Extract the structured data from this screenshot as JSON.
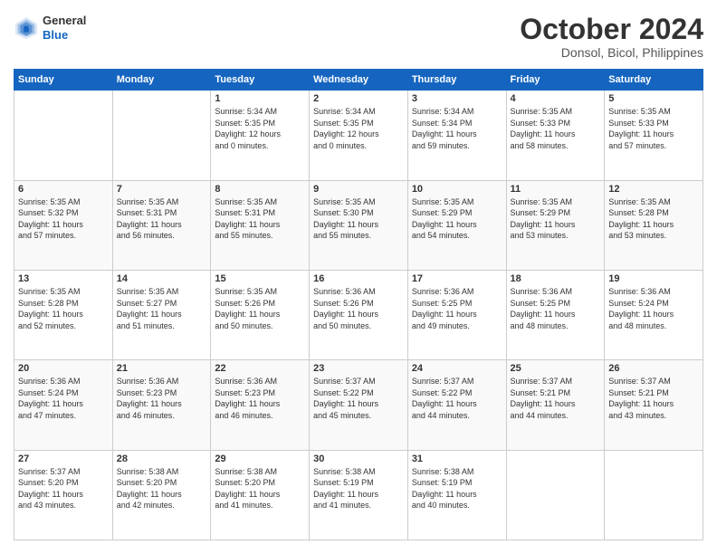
{
  "logo": {
    "line1": "General",
    "line2": "Blue"
  },
  "header": {
    "month": "October 2024",
    "location": "Donsol, Bicol, Philippines"
  },
  "days_of_week": [
    "Sunday",
    "Monday",
    "Tuesday",
    "Wednesday",
    "Thursday",
    "Friday",
    "Saturday"
  ],
  "weeks": [
    [
      {
        "day": "",
        "info": ""
      },
      {
        "day": "",
        "info": ""
      },
      {
        "day": "1",
        "info": "Sunrise: 5:34 AM\nSunset: 5:35 PM\nDaylight: 12 hours\nand 0 minutes."
      },
      {
        "day": "2",
        "info": "Sunrise: 5:34 AM\nSunset: 5:35 PM\nDaylight: 12 hours\nand 0 minutes."
      },
      {
        "day": "3",
        "info": "Sunrise: 5:34 AM\nSunset: 5:34 PM\nDaylight: 11 hours\nand 59 minutes."
      },
      {
        "day": "4",
        "info": "Sunrise: 5:35 AM\nSunset: 5:33 PM\nDaylight: 11 hours\nand 58 minutes."
      },
      {
        "day": "5",
        "info": "Sunrise: 5:35 AM\nSunset: 5:33 PM\nDaylight: 11 hours\nand 57 minutes."
      }
    ],
    [
      {
        "day": "6",
        "info": "Sunrise: 5:35 AM\nSunset: 5:32 PM\nDaylight: 11 hours\nand 57 minutes."
      },
      {
        "day": "7",
        "info": "Sunrise: 5:35 AM\nSunset: 5:31 PM\nDaylight: 11 hours\nand 56 minutes."
      },
      {
        "day": "8",
        "info": "Sunrise: 5:35 AM\nSunset: 5:31 PM\nDaylight: 11 hours\nand 55 minutes."
      },
      {
        "day": "9",
        "info": "Sunrise: 5:35 AM\nSunset: 5:30 PM\nDaylight: 11 hours\nand 55 minutes."
      },
      {
        "day": "10",
        "info": "Sunrise: 5:35 AM\nSunset: 5:29 PM\nDaylight: 11 hours\nand 54 minutes."
      },
      {
        "day": "11",
        "info": "Sunrise: 5:35 AM\nSunset: 5:29 PM\nDaylight: 11 hours\nand 53 minutes."
      },
      {
        "day": "12",
        "info": "Sunrise: 5:35 AM\nSunset: 5:28 PM\nDaylight: 11 hours\nand 53 minutes."
      }
    ],
    [
      {
        "day": "13",
        "info": "Sunrise: 5:35 AM\nSunset: 5:28 PM\nDaylight: 11 hours\nand 52 minutes."
      },
      {
        "day": "14",
        "info": "Sunrise: 5:35 AM\nSunset: 5:27 PM\nDaylight: 11 hours\nand 51 minutes."
      },
      {
        "day": "15",
        "info": "Sunrise: 5:35 AM\nSunset: 5:26 PM\nDaylight: 11 hours\nand 50 minutes."
      },
      {
        "day": "16",
        "info": "Sunrise: 5:36 AM\nSunset: 5:26 PM\nDaylight: 11 hours\nand 50 minutes."
      },
      {
        "day": "17",
        "info": "Sunrise: 5:36 AM\nSunset: 5:25 PM\nDaylight: 11 hours\nand 49 minutes."
      },
      {
        "day": "18",
        "info": "Sunrise: 5:36 AM\nSunset: 5:25 PM\nDaylight: 11 hours\nand 48 minutes."
      },
      {
        "day": "19",
        "info": "Sunrise: 5:36 AM\nSunset: 5:24 PM\nDaylight: 11 hours\nand 48 minutes."
      }
    ],
    [
      {
        "day": "20",
        "info": "Sunrise: 5:36 AM\nSunset: 5:24 PM\nDaylight: 11 hours\nand 47 minutes."
      },
      {
        "day": "21",
        "info": "Sunrise: 5:36 AM\nSunset: 5:23 PM\nDaylight: 11 hours\nand 46 minutes."
      },
      {
        "day": "22",
        "info": "Sunrise: 5:36 AM\nSunset: 5:23 PM\nDaylight: 11 hours\nand 46 minutes."
      },
      {
        "day": "23",
        "info": "Sunrise: 5:37 AM\nSunset: 5:22 PM\nDaylight: 11 hours\nand 45 minutes."
      },
      {
        "day": "24",
        "info": "Sunrise: 5:37 AM\nSunset: 5:22 PM\nDaylight: 11 hours\nand 44 minutes."
      },
      {
        "day": "25",
        "info": "Sunrise: 5:37 AM\nSunset: 5:21 PM\nDaylight: 11 hours\nand 44 minutes."
      },
      {
        "day": "26",
        "info": "Sunrise: 5:37 AM\nSunset: 5:21 PM\nDaylight: 11 hours\nand 43 minutes."
      }
    ],
    [
      {
        "day": "27",
        "info": "Sunrise: 5:37 AM\nSunset: 5:20 PM\nDaylight: 11 hours\nand 43 minutes."
      },
      {
        "day": "28",
        "info": "Sunrise: 5:38 AM\nSunset: 5:20 PM\nDaylight: 11 hours\nand 42 minutes."
      },
      {
        "day": "29",
        "info": "Sunrise: 5:38 AM\nSunset: 5:20 PM\nDaylight: 11 hours\nand 41 minutes."
      },
      {
        "day": "30",
        "info": "Sunrise: 5:38 AM\nSunset: 5:19 PM\nDaylight: 11 hours\nand 41 minutes."
      },
      {
        "day": "31",
        "info": "Sunrise: 5:38 AM\nSunset: 5:19 PM\nDaylight: 11 hours\nand 40 minutes."
      },
      {
        "day": "",
        "info": ""
      },
      {
        "day": "",
        "info": ""
      }
    ]
  ]
}
